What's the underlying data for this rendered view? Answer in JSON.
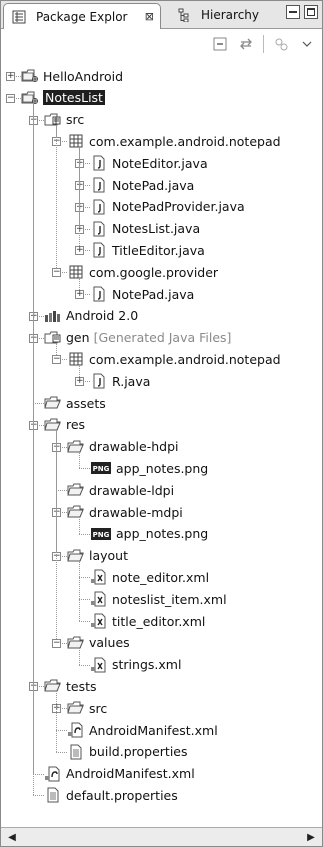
{
  "tabs": {
    "package_explorer": "Package Explor",
    "close": "⊠",
    "hierarchy": "Hierarchy"
  },
  "tree": [
    {
      "id": "helloandroid",
      "label": "HelloAndroid",
      "level": 0,
      "toggle": "+",
      "icon": "project-icon",
      "selected": false
    },
    {
      "id": "noteslist",
      "label": "NotesList",
      "level": 0,
      "toggle": "−",
      "icon": "project-icon",
      "selected": true
    },
    {
      "id": "src",
      "label": "src",
      "level": 1,
      "toggle": "−",
      "icon": "source-folder-icon"
    },
    {
      "id": "pkg-notepad",
      "label": "com.example.android.notepad",
      "level": 2,
      "toggle": "−",
      "icon": "package-icon"
    },
    {
      "id": "noteeditor",
      "label": "NoteEditor.java",
      "level": 3,
      "toggle": "+",
      "icon": "java-file-icon"
    },
    {
      "id": "notepad",
      "label": "NotePad.java",
      "level": 3,
      "toggle": "+",
      "icon": "java-file-icon"
    },
    {
      "id": "notepadprovider",
      "label": "NotePadProvider.java",
      "level": 3,
      "toggle": "+",
      "icon": "java-file-icon"
    },
    {
      "id": "noteslistjava",
      "label": "NotesList.java",
      "level": 3,
      "toggle": "+",
      "icon": "java-file-icon"
    },
    {
      "id": "titleeditor",
      "label": "TitleEditor.java",
      "level": 3,
      "toggle": "+",
      "icon": "java-file-icon"
    },
    {
      "id": "pkg-google",
      "label": "com.google.provider",
      "level": 2,
      "toggle": "−",
      "icon": "package-icon"
    },
    {
      "id": "notepad2",
      "label": "NotePad.java",
      "level": 3,
      "toggle": "+",
      "icon": "java-file-icon"
    },
    {
      "id": "android20",
      "label": "Android 2.0",
      "level": 1,
      "toggle": "+",
      "icon": "library-icon"
    },
    {
      "id": "gen",
      "label": "gen",
      "decoration": "[Generated Java Files]",
      "level": 1,
      "toggle": "−",
      "icon": "gen-folder-icon"
    },
    {
      "id": "gen-pkg",
      "label": "com.example.android.notepad",
      "level": 2,
      "toggle": "−",
      "icon": "package-icon"
    },
    {
      "id": "rjava",
      "label": "R.java",
      "level": 3,
      "toggle": "+",
      "icon": "java-file-icon"
    },
    {
      "id": "assets",
      "label": "assets",
      "level": 1,
      "toggle": null,
      "icon": "folder-icon"
    },
    {
      "id": "res",
      "label": "res",
      "level": 1,
      "toggle": "−",
      "icon": "folder-icon"
    },
    {
      "id": "drawable-hdpi",
      "label": "drawable-hdpi",
      "level": 2,
      "toggle": "−",
      "icon": "folder-icon"
    },
    {
      "id": "app-notes-hdpi",
      "label": "app_notes.png",
      "level": 3,
      "toggle": null,
      "icon": "png-file-icon"
    },
    {
      "id": "drawable-ldpi",
      "label": "drawable-ldpi",
      "level": 2,
      "toggle": null,
      "icon": "folder-icon"
    },
    {
      "id": "drawable-mdpi",
      "label": "drawable-mdpi",
      "level": 2,
      "toggle": "−",
      "icon": "folder-icon"
    },
    {
      "id": "app-notes-mdpi",
      "label": "app_notes.png",
      "level": 3,
      "toggle": null,
      "icon": "png-file-icon"
    },
    {
      "id": "layout",
      "label": "layout",
      "level": 2,
      "toggle": "−",
      "icon": "folder-icon"
    },
    {
      "id": "note-editor-xml",
      "label": "note_editor.xml",
      "level": 3,
      "toggle": null,
      "icon": "xml-file-icon"
    },
    {
      "id": "noteslist-item-xml",
      "label": "noteslist_item.xml",
      "level": 3,
      "toggle": null,
      "icon": "xml-file-icon"
    },
    {
      "id": "title-editor-xml",
      "label": "title_editor.xml",
      "level": 3,
      "toggle": null,
      "icon": "xml-file-icon"
    },
    {
      "id": "values",
      "label": "values",
      "level": 2,
      "toggle": "−",
      "icon": "folder-icon"
    },
    {
      "id": "strings-xml",
      "label": "strings.xml",
      "level": 3,
      "toggle": null,
      "icon": "xml-file-icon"
    },
    {
      "id": "tests",
      "label": "tests",
      "level": 1,
      "toggle": "−",
      "icon": "folder-icon"
    },
    {
      "id": "tests-src",
      "label": "src",
      "level": 2,
      "toggle": "+",
      "icon": "folder-icon"
    },
    {
      "id": "tests-manifest",
      "label": "AndroidManifest.xml",
      "level": 2,
      "toggle": null,
      "icon": "manifest-file-icon"
    },
    {
      "id": "build-properties",
      "label": "build.properties",
      "level": 2,
      "toggle": null,
      "icon": "text-file-icon"
    },
    {
      "id": "manifest",
      "label": "AndroidManifest.xml",
      "level": 1,
      "toggle": null,
      "icon": "manifest-file-icon"
    },
    {
      "id": "default-properties",
      "label": "default.properties",
      "level": 1,
      "toggle": null,
      "icon": "text-file-icon"
    }
  ],
  "colors": {
    "selection_bg": "#1f1f1f",
    "selection_fg": "#ffffff",
    "decoration_grey": "#8a8a8a"
  }
}
